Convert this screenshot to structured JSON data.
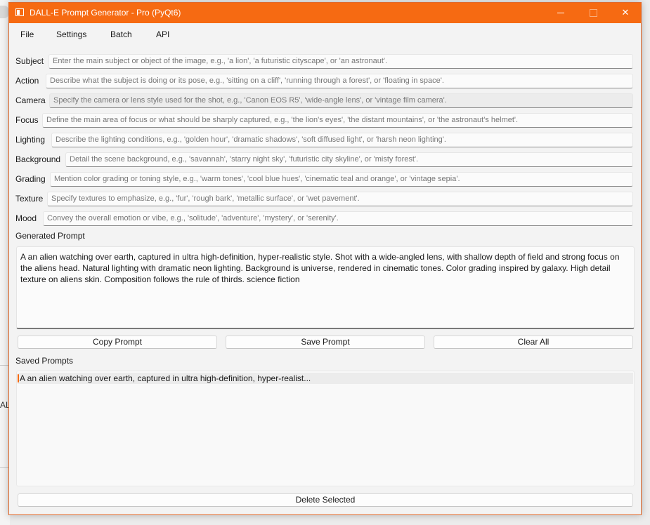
{
  "desktop": {
    "fragment_char": "AL"
  },
  "window": {
    "title": "DALL-E Prompt Generator - Pro (PyQt6)",
    "controls": {
      "minimize": "—",
      "close": "✕"
    }
  },
  "menu": [
    "File",
    "Settings",
    "Batch",
    "API"
  ],
  "fields": [
    {
      "label": "Subject",
      "placeholder": "Enter the main subject or object of the image, e.g., 'a lion', 'a futuristic cityscape', or 'an astronaut'."
    },
    {
      "label": "Action",
      "placeholder": "Describe what the subject is doing or its pose, e.g., 'sitting on a cliff', 'running through a forest', or 'floating in space'."
    },
    {
      "label": "Camera",
      "placeholder": "Specify the camera or lens style used for the shot, e.g., 'Canon EOS R5', 'wide-angle lens', or 'vintage film camera'."
    },
    {
      "label": "Focus",
      "placeholder": "Define the main area of focus or what should be sharply captured, e.g., 'the lion's eyes', 'the distant mountains', or 'the astronaut's helmet'."
    },
    {
      "label": "Lighting",
      "placeholder": "Describe the lighting conditions, e.g., 'golden hour', 'dramatic shadows', 'soft diffused light', or 'harsh neon lighting'."
    },
    {
      "label": "Background",
      "placeholder": "Detail the scene background, e.g., 'savannah', 'starry night sky', 'futuristic city skyline', or 'misty forest'."
    },
    {
      "label": "Grading",
      "placeholder": "Mention color grading or toning style, e.g., 'warm tones', 'cool blue hues', 'cinematic teal and orange', or 'vintage sepia'."
    },
    {
      "label": "Texture",
      "placeholder": "Specify textures to emphasize, e.g., 'fur', 'rough bark', 'metallic surface', or 'wet pavement'."
    },
    {
      "label": "Mood",
      "placeholder": "Convey the overall emotion or vibe, e.g., 'solitude', 'adventure', 'mystery', or 'serenity'."
    }
  ],
  "generated": {
    "label": "Generated Prompt",
    "text": "A an alien watching over earth, captured in ultra high-definition, hyper-realistic style. Shot with a wide-angled lens, with shallow depth of field and strong focus on the aliens head. Natural lighting with dramatic neon lighting. Background is universe, rendered in cinematic tones. Color grading inspired by galaxy. High detail texture on aliens skin. Composition follows the rule of thirds. science fiction"
  },
  "buttons": {
    "copy": "Copy Prompt",
    "save": "Save Prompt",
    "clear": "Clear All",
    "delete": "Delete Selected"
  },
  "saved": {
    "label": "Saved Prompts",
    "items": [
      "A an alien watching over earth, captured in ultra high-definition, hyper-realist..."
    ]
  },
  "colors": {
    "accent": "#f66a12"
  }
}
